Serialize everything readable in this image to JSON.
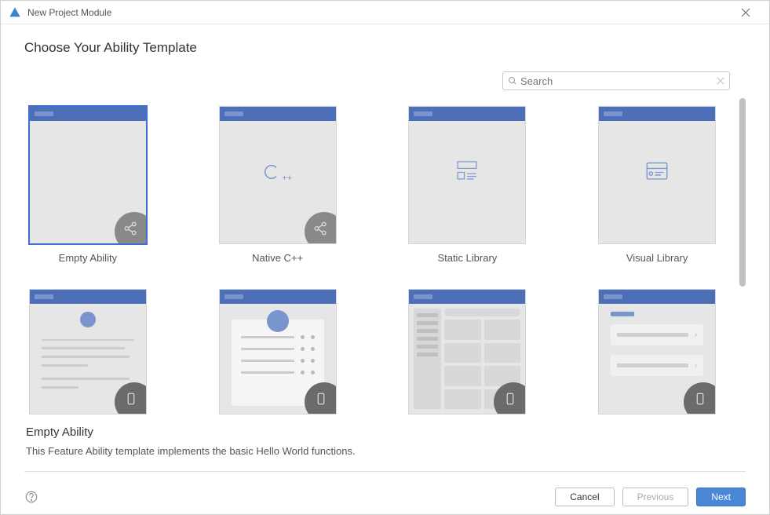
{
  "window": {
    "title": "New Project Module"
  },
  "heading": "Choose Your Ability Template",
  "search": {
    "placeholder": "Search",
    "value": ""
  },
  "templates": [
    {
      "id": "empty-ability",
      "label": "Empty Ability",
      "selected": true,
      "badge": "share"
    },
    {
      "id": "native-cpp",
      "label": "Native C++",
      "selected": false,
      "badge": "share"
    },
    {
      "id": "static-library",
      "label": "Static Library",
      "selected": false,
      "badge": null
    },
    {
      "id": "visual-library",
      "label": "Visual Library",
      "selected": false,
      "badge": null
    },
    {
      "id": "profile",
      "label": "",
      "selected": false,
      "badge": "phone"
    },
    {
      "id": "form",
      "label": "",
      "selected": false,
      "badge": "phone"
    },
    {
      "id": "navigation",
      "label": "",
      "selected": false,
      "badge": "phone"
    },
    {
      "id": "cards",
      "label": "",
      "selected": false,
      "badge": "phone"
    }
  ],
  "description": {
    "title": "Empty Ability",
    "text": "This Feature Ability template implements the basic Hello World functions."
  },
  "footer": {
    "cancel": "Cancel",
    "previous": "Previous",
    "next": "Next",
    "previous_disabled": true
  }
}
